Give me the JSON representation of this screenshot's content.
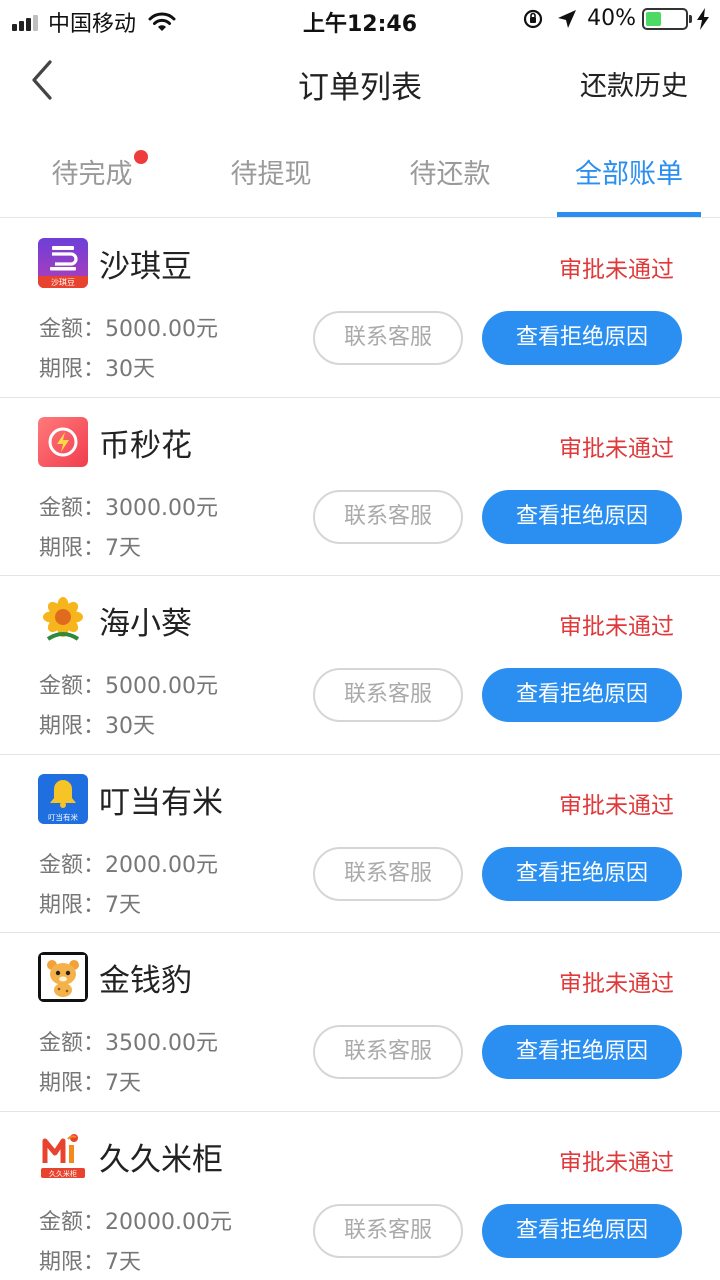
{
  "status_bar": {
    "carrier": "中国移动",
    "time": "上午12:46",
    "battery_percent": "40%",
    "battery_level": 0.4,
    "icons": [
      "signal-icon",
      "wifi-icon",
      "orientation-lock-icon",
      "location-arrow-icon",
      "battery-icon",
      "charging-bolt-icon"
    ]
  },
  "nav": {
    "back_icon": "chevron-left-icon",
    "title": "订单列表",
    "right_action": "还款历史"
  },
  "tabs": {
    "items": [
      {
        "label": "待完成",
        "badge_dot": true
      },
      {
        "label": "待提现",
        "badge_dot": false
      },
      {
        "label": "待还款",
        "badge_dot": false
      },
      {
        "label": "全部账单",
        "badge_dot": false
      }
    ],
    "active_index": 3
  },
  "orders": [
    {
      "name": "沙琪豆",
      "status": "审批未通过",
      "amount_label": "金额：",
      "amount": "5000.00元",
      "term_label": "期限：",
      "term": "30天",
      "contact_button": "联系客服",
      "reason_button": "查看拒绝原因",
      "icon": "shaqidou-logo-icon",
      "icon_text": "沙琪豆"
    },
    {
      "name": "币秒花",
      "status": "审批未通过",
      "amount_label": "金额：",
      "amount": "3000.00元",
      "term_label": "期限：",
      "term": "7天",
      "contact_button": "联系客服",
      "reason_button": "查看拒绝原因",
      "icon": "bimiaohua-logo-icon"
    },
    {
      "name": "海小葵",
      "status": "审批未通过",
      "amount_label": "金额：",
      "amount": "5000.00元",
      "term_label": "期限：",
      "term": "30天",
      "contact_button": "联系客服",
      "reason_button": "查看拒绝原因",
      "icon": "sunflower-logo-icon"
    },
    {
      "name": "叮当有米",
      "status": "审批未通过",
      "amount_label": "金额：",
      "amount": "2000.00元",
      "term_label": "期限：",
      "term": "7天",
      "contact_button": "联系客服",
      "reason_button": "查看拒绝原因",
      "icon": "bell-logo-icon",
      "icon_text": "叮当有米"
    },
    {
      "name": "金钱豹",
      "status": "审批未通过",
      "amount_label": "金额：",
      "amount": "3500.00元",
      "term_label": "期限：",
      "term": "7天",
      "contact_button": "联系客服",
      "reason_button": "查看拒绝原因",
      "icon": "leopard-logo-icon"
    },
    {
      "name": "久久米柜",
      "status": "审批未通过",
      "amount_label": "金额：",
      "amount": "20000.00元",
      "term_label": "期限：",
      "term": "7天",
      "contact_button": "联系客服",
      "reason_button": "查看拒绝原因",
      "icon": "jiujiumigui-logo-icon",
      "icon_text": "久久米柜"
    }
  ],
  "colors": {
    "accent": "#2a8ff0",
    "status_rejected": "#e0393b",
    "badge_dot": "#ee3b3b",
    "battery_fill": "#4cd964"
  }
}
